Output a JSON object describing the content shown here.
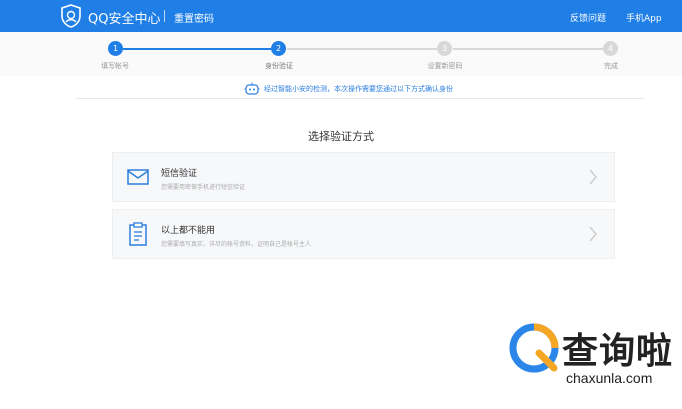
{
  "header": {
    "brand": "QQ安全中心",
    "page_name": "重置密码",
    "links": {
      "feedback": "反馈问题",
      "mobile_app": "手机App"
    },
    "bg_color": "#1f7fe6"
  },
  "steps": [
    {
      "num": "1",
      "label": "填写帐号",
      "state": "done"
    },
    {
      "num": "2",
      "label": "身份验证",
      "state": "active"
    },
    {
      "num": "3",
      "label": "设置新密码",
      "state": "pending"
    },
    {
      "num": "4",
      "label": "完成",
      "state": "pending"
    }
  ],
  "notice": {
    "text": "经过智能小安的检测，本次操作需要您通过以下方式确认身份",
    "icon": "robot-icon"
  },
  "section_title": "选择验证方式",
  "options": [
    {
      "title": "短信验证",
      "desc": "您需要用密保手机进行短信验证",
      "icon": "envelope-icon"
    },
    {
      "title": "以上都不能用",
      "desc": "您需要填写真实、详尽的帐号资料，证明自己是帐号主人",
      "icon": "clipboard-icon"
    }
  ],
  "watermark": {
    "text": "查询啦",
    "url": "chaxunla.com"
  },
  "colors": {
    "accent": "#1f7fe6",
    "step_pending": "#d8d8d8",
    "notice_text": "#2b7de0"
  }
}
